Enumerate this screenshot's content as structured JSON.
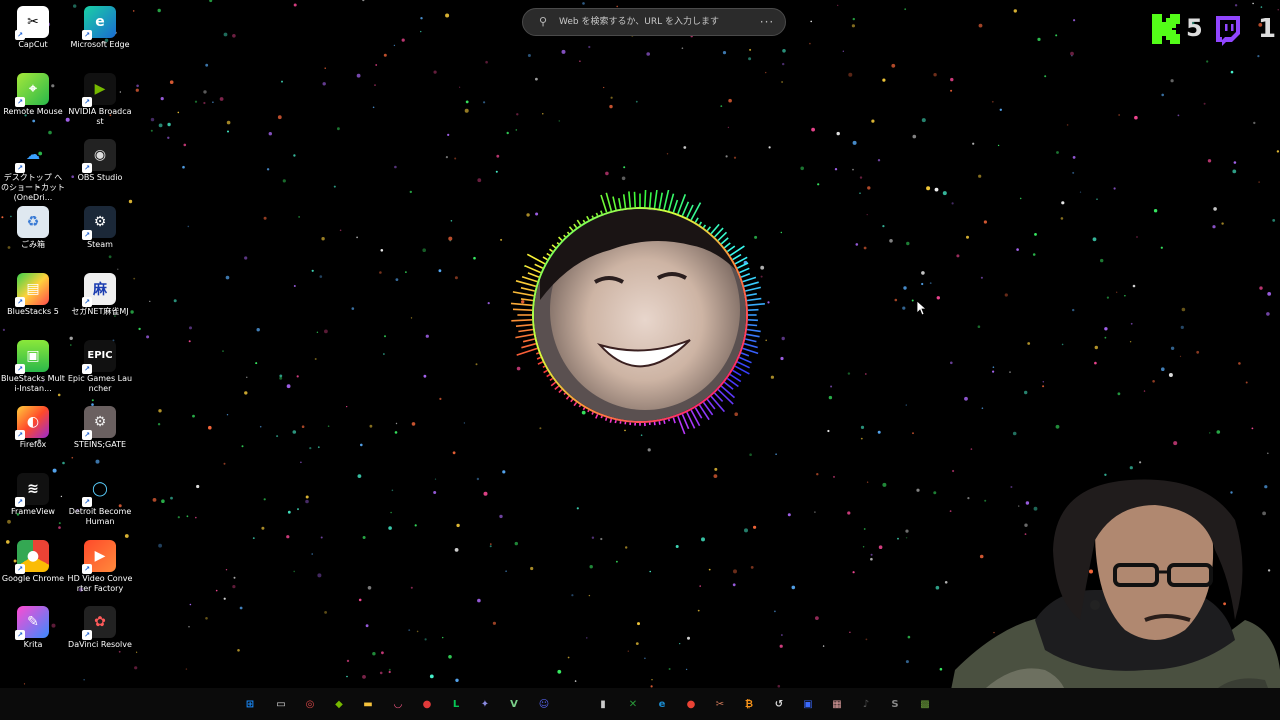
{
  "search": {
    "placeholder": "Web を検索するか、URL を入力します",
    "more_label": "···"
  },
  "overlay": {
    "kick_count": "5",
    "twitch_count": "1"
  },
  "desktop_icons": [
    {
      "label": "CapCut",
      "icon": "capcut-icon"
    },
    {
      "label": "Microsoft Edge",
      "icon": "edge-icon"
    },
    {
      "label": "Remote Mouse",
      "icon": "remote-mouse-icon"
    },
    {
      "label": "NVIDIA Broadcast",
      "icon": "nvidia-broadcast-icon"
    },
    {
      "label": "デスクトップ へのショートカット (OneDri...",
      "icon": "onedrive-icon"
    },
    {
      "label": "OBS Studio",
      "icon": "obs-icon"
    },
    {
      "label": "ごみ箱",
      "icon": "recycle-bin-icon"
    },
    {
      "label": "Steam",
      "icon": "steam-icon"
    },
    {
      "label": "BlueStacks 5",
      "icon": "bluestacks-icon"
    },
    {
      "label": "セガNET麻雀MJ",
      "icon": "sega-mj-icon"
    },
    {
      "label": "BlueStacks Multi-Instan...",
      "icon": "bluestacks-multi-icon"
    },
    {
      "label": "Epic Games Launcher",
      "icon": "epic-games-icon",
      "icon_text": "EPIC"
    },
    {
      "label": "Firefox",
      "icon": "firefox-icon"
    },
    {
      "label": "STEINS;GATE",
      "icon": "steins-gate-icon"
    },
    {
      "label": "FrameView",
      "icon": "frameview-icon"
    },
    {
      "label": "Detroit Become Human",
      "icon": "detroit-icon"
    },
    {
      "label": "Google Chrome",
      "icon": "chrome-icon"
    },
    {
      "label": "HD Video Converter Factory",
      "icon": "hd-video-converter-icon"
    },
    {
      "label": "Krita",
      "icon": "krita-icon"
    },
    {
      "label": "DaVinci Resolve",
      "icon": "davinci-resolve-icon"
    }
  ],
  "taskbar_icons": [
    "start-icon",
    "task-view-icon",
    "app-icon",
    "nvidia-icon",
    "file-explorer-icon",
    "lips-icon",
    "record-icon",
    "line-icon",
    "chat-icon",
    "notes-icon",
    "discord-icon",
    "app2-icon",
    "xbox-icon",
    "edge-icon",
    "chrome-icon",
    "tools-icon",
    "bitcoin-icon",
    "back-icon",
    "app3-icon",
    "photo-icon",
    "app4-icon",
    "app5-icon",
    "minecraft-icon"
  ],
  "colors": {
    "background": "#000000",
    "kick_green": "#53fc18",
    "twitch_purple": "#9146ff",
    "taskbar": "#0b0b0b"
  }
}
